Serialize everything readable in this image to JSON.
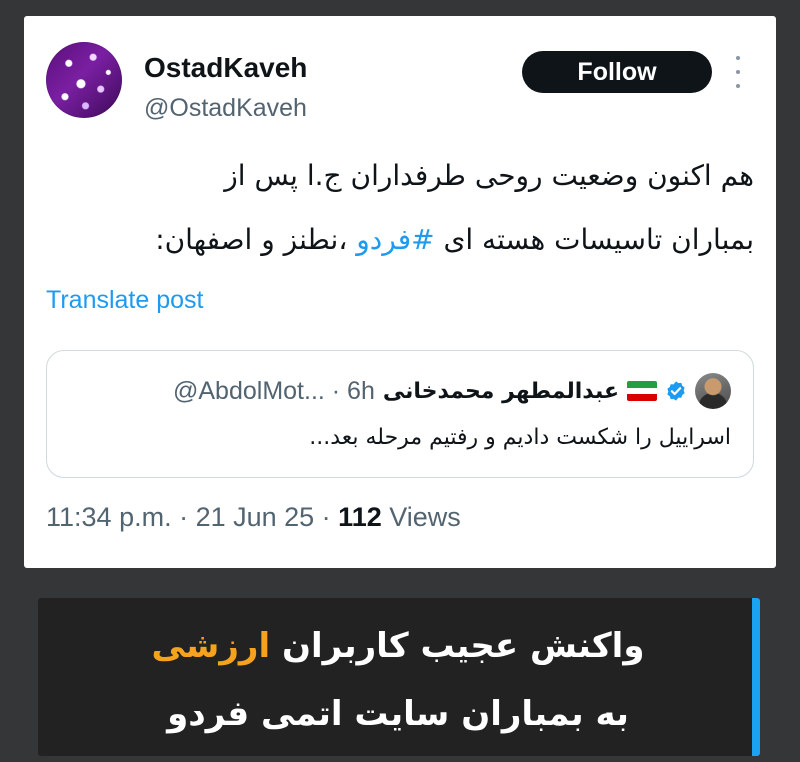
{
  "tweet": {
    "display_name": "OstadKaveh",
    "handle": "@OstadKaveh",
    "follow_label": "Follow",
    "text_line1": "هم اکنون وضعیت روحی طرفداران ج.ا پس از",
    "text_line2_before": "بمباران تاسیسات هسته ای ",
    "hashtag": "#فردو",
    "text_line2_after": " ،نطنز و اصفهان:",
    "translate_label": "Translate post",
    "quote": {
      "name": "عبدالمطهر محمدخانی",
      "handle": "@AbdolMot... · 6h",
      "text": "اسراییل را شکست دادیم و رفتیم مرحله بعد..."
    },
    "time": "11:34 p.m. · 21 Jun 25 · ",
    "views_count": "112",
    "views_label": " Views"
  },
  "banner": {
    "line1_before": "واکنش عجیب کاربران ",
    "line1_highlight": "ارزشی",
    "line2": "به بمباران سایت اتمی فردو"
  },
  "colors": {
    "accent_blue": "#1d9bf0",
    "banner_orange": "#f6a21c",
    "banner_bg": "#222222",
    "page_bg": "#343638"
  },
  "icons": {
    "verified": "verified-badge-icon",
    "flag": "iran-flag-icon",
    "more": "more-vertical-icon"
  }
}
